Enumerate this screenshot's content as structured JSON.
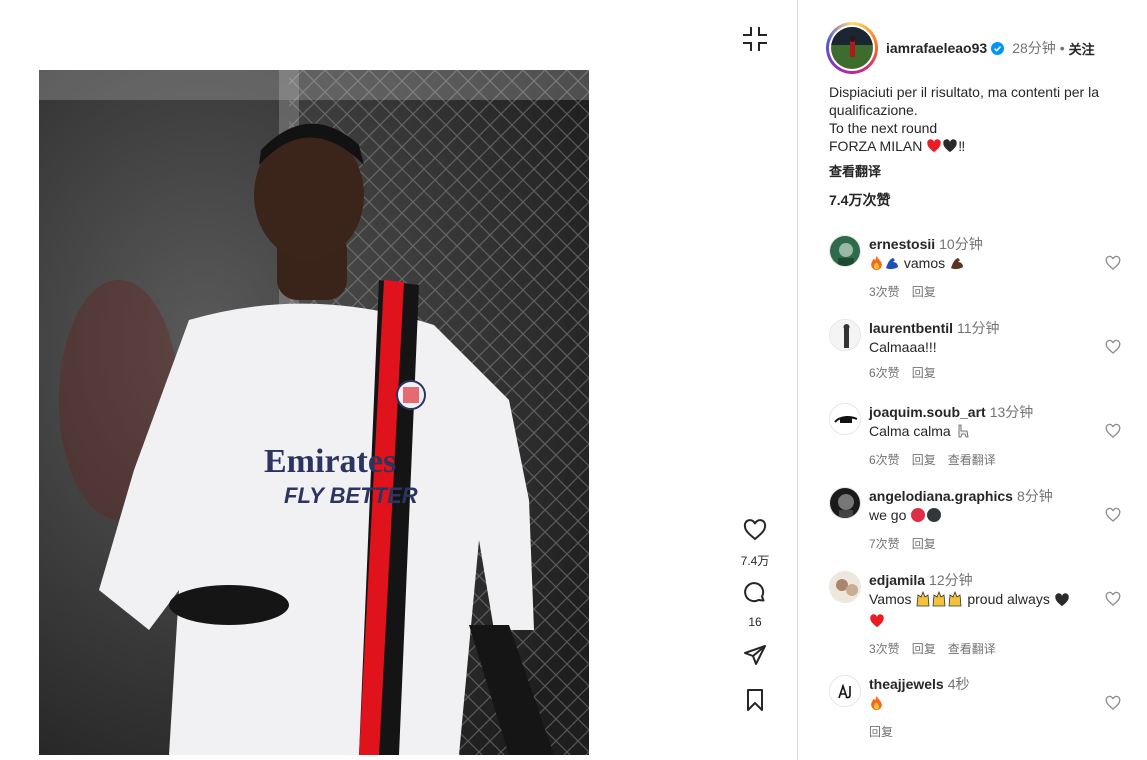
{
  "post": {
    "username": "iamrafaeleao93",
    "time": "28分钟",
    "dot": "•",
    "follow": "关注",
    "caption_lines": [
      "Dispiaciuti per il risultato, ma contenti per la",
      "qualificazione.",
      "To the next round",
      "FORZA MILAN"
    ],
    "caption_tail": "‼",
    "see_translation": "查看翻译",
    "likes": "7.4万次赞",
    "photo_text": {
      "sponsor_line1": "Emirates",
      "sponsor_line2": "FLY BETTER"
    }
  },
  "actions": {
    "like_count": "7.4万",
    "comment_count": "16",
    "like_icon": "heart-icon",
    "comment_icon": "comment-bubble-icon",
    "share_icon": "paper-plane-icon",
    "save_icon": "bookmark-icon"
  },
  "comments": [
    {
      "user": "ernestosii",
      "time": "10分钟",
      "text": "vamos",
      "likes": "3次赞",
      "reply": "回复",
      "translate": ""
    },
    {
      "user": "laurentbentil",
      "time": "11分钟",
      "text": "Calmaaa!!!",
      "likes": "6次赞",
      "reply": "回复",
      "translate": ""
    },
    {
      "user": "joaquim.soub_art",
      "time": "13分钟",
      "text": "Calma calma",
      "likes": "6次赞",
      "reply": "回复",
      "translate": "查看翻译"
    },
    {
      "user": "angelodiana.graphics",
      "time": "8分钟",
      "text": "we go",
      "likes": "7次赞",
      "reply": "回复",
      "translate": ""
    },
    {
      "user": "edjamila",
      "time": "12分钟",
      "text": "Vamos",
      "text2": "proud always",
      "likes": "3次赞",
      "reply": "回复",
      "translate": "查看翻译"
    },
    {
      "user": "theajjewels",
      "time": "4秒",
      "text": "",
      "likes": "",
      "reply": "回复",
      "translate": ""
    }
  ],
  "colors": {
    "verified": "#0095f6",
    "secondary_text": "#737373",
    "heart_red": "#ed1c24",
    "milan_red": "#e0121b"
  }
}
